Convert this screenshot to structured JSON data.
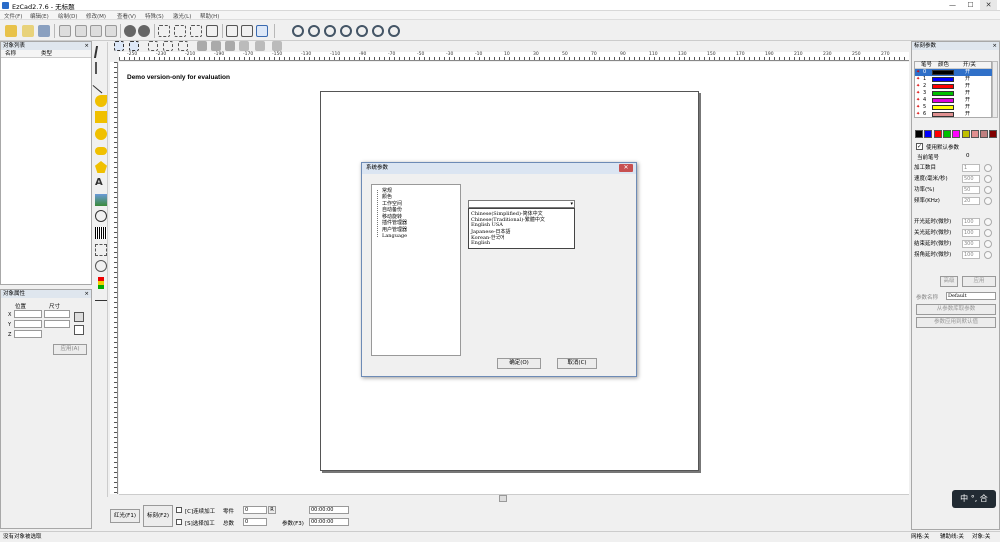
{
  "window": {
    "title": "EzCad2.7.6 - 无标题",
    "min": "—",
    "max": "☐",
    "close": "✕"
  },
  "menu": [
    "文件(F)",
    "编辑(E)",
    "绘制(D)",
    "修改(M)",
    "查看(V)",
    "特殊(S)",
    "激光(L)",
    "帮助(H)"
  ],
  "left_panel": {
    "object_list": {
      "title": "对象列表",
      "col_name": "名称",
      "col_type": "类型"
    },
    "object_props": {
      "title": "对象属性",
      "pos_label": "位置",
      "size_label": "尺寸",
      "x": "X",
      "y": "Y",
      "z": "Z",
      "apply": "应用(A)"
    }
  },
  "canvas": {
    "demo_text": "Demo version-only for evaluation",
    "ruler_labels": [
      "-250",
      "-230",
      "-210",
      "-190",
      "-170",
      "-150",
      "-130",
      "-110",
      "-90",
      "-70",
      "-50",
      "-30",
      "-10",
      "10",
      "30",
      "50",
      "70",
      "90",
      "110",
      "130",
      "150",
      "170",
      "190",
      "210",
      "230",
      "250",
      "270"
    ]
  },
  "dialog": {
    "title": "系统参数",
    "close": "✕",
    "tree": [
      "常规",
      "颜色",
      "工作空间",
      "自动备份",
      "移动旋转",
      "插件管理器",
      "用户管理器",
      "Language"
    ],
    "combo_value": "",
    "options": [
      "Chinese(Simplified)-简体中文",
      "Chinese(Traditional)-繁體中文",
      "English USA",
      "Japanese-日本語",
      "Korean-한국어",
      "English"
    ],
    "ok": "确定(O)",
    "cancel": "取消(C)"
  },
  "right_panel": {
    "title": "标刻参数",
    "cols": {
      "pen": "笔号",
      "color": "颜色",
      "onoff": "开/关"
    },
    "pens": [
      {
        "num": "0",
        "color": "#000000",
        "on": "开"
      },
      {
        "num": "1",
        "color": "#0000ff",
        "on": "开"
      },
      {
        "num": "2",
        "color": "#ff0000",
        "on": "开"
      },
      {
        "num": "3",
        "color": "#00c000",
        "on": "开"
      },
      {
        "num": "4",
        "color": "#e000e0",
        "on": "开"
      },
      {
        "num": "5",
        "color": "#ffff00",
        "on": "开"
      },
      {
        "num": "6",
        "color": "#e09090",
        "on": "开"
      }
    ],
    "swatches": [
      "#000000",
      "#0000ff",
      "#ff0000",
      "#00c000",
      "#ff00ff",
      "#c0c000",
      "#e09090",
      "#c08080",
      "#800000"
    ],
    "use_default": "使用默认参数",
    "current_pen_label": "当前笔号",
    "current_pen": "0",
    "params": [
      {
        "label": "加工数目",
        "value": "1"
      },
      {
        "label": "速度(毫米/秒)",
        "value": "500"
      },
      {
        "label": "功率(%)",
        "value": "50"
      },
      {
        "label": "频率(KHz)",
        "value": "20"
      }
    ],
    "delays": [
      {
        "label": "开光延时(微秒)",
        "value": "100"
      },
      {
        "label": "关光延时(微秒)",
        "value": "100"
      },
      {
        "label": "结束延时(微秒)",
        "value": "300"
      },
      {
        "label": "拐角延时(微秒)",
        "value": "100"
      }
    ],
    "advanced": "高级",
    "apply_all": "应用",
    "param_name_label": "参数名称",
    "param_name": "Default",
    "load_btn": "从参数库取参数",
    "save_btn": "参数应用到默认值"
  },
  "bottom": {
    "red": "红光(F1)",
    "mark": "标刻(F2)",
    "continuous": "[C]连续加工",
    "select": "[S]选择加工",
    "part_label": "零件",
    "part_value": "0",
    "total_label": "总数",
    "total_value": "0",
    "r_btn": "R",
    "params_btn": "参数(F3)",
    "time1": "00:00:00",
    "time2": "00:00:00"
  },
  "status": {
    "left": "没有对象被选取",
    "grid": "网格:关",
    "guide": "辅助线:关",
    "snap": "对象:关"
  },
  "ime": "中 °, 合"
}
